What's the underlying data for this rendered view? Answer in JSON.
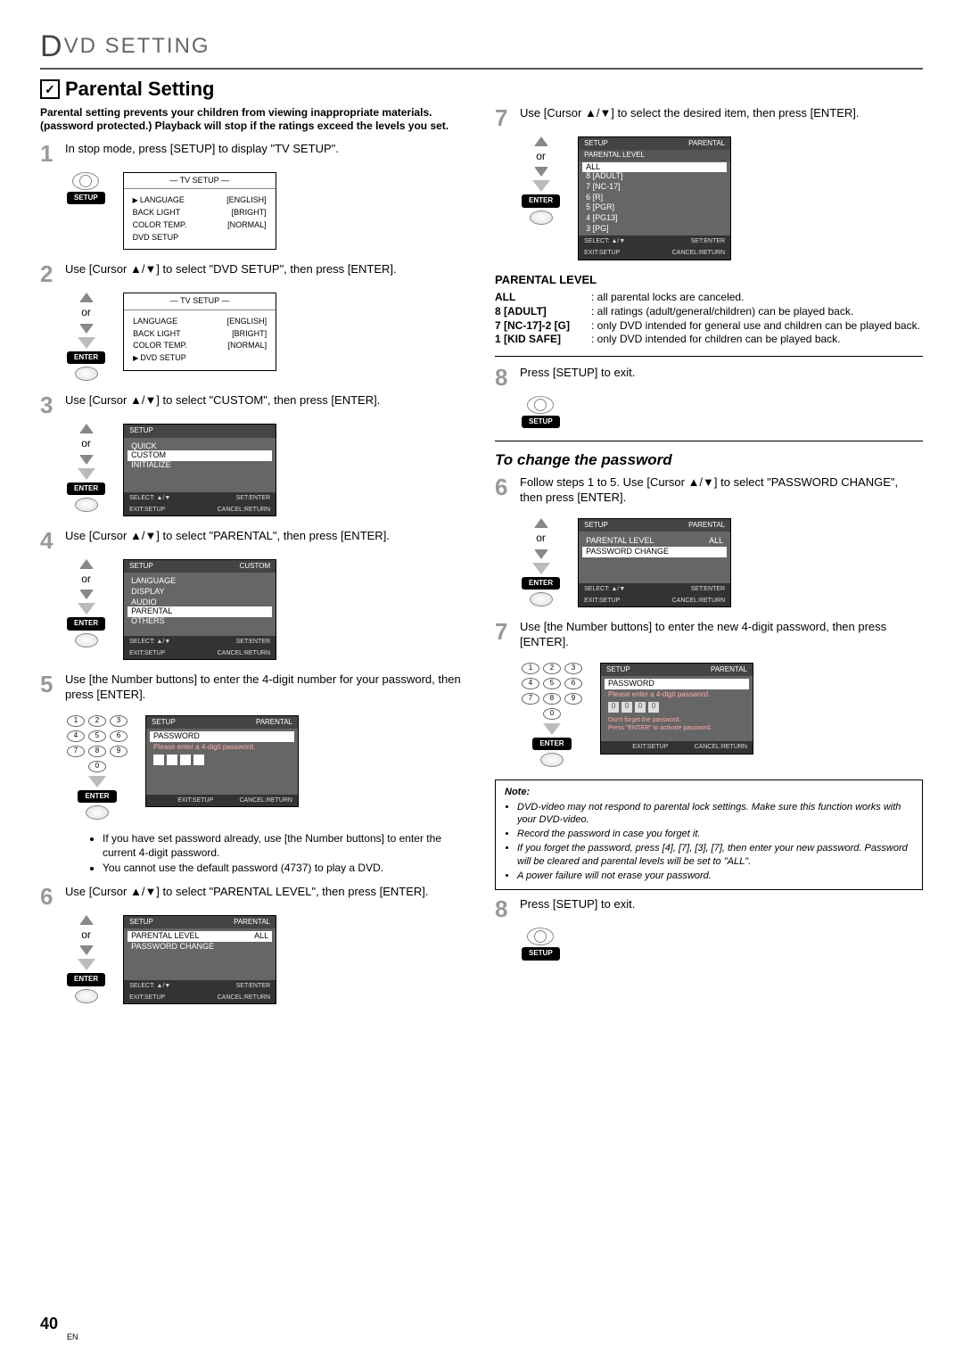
{
  "page_title": {
    "d": "D",
    "rest": "VD SETTING"
  },
  "section_title": "Parental Setting",
  "intro": "Parental setting prevents your children from viewing inappropriate materials. (password protected.) Playback will stop if the ratings exceed the levels you set.",
  "steps": {
    "1": "In stop mode, press [SETUP] to display \"TV SETUP\".",
    "2": "Use [Cursor ▲/▼] to select \"DVD SETUP\", then press [ENTER].",
    "3": "Use [Cursor ▲/▼] to select \"CUSTOM\", then press [ENTER].",
    "4": "Use [Cursor ▲/▼] to select \"PARENTAL\", then press [ENTER].",
    "5": "Use [the Number buttons] to enter the 4-digit number for your password, then press [ENTER].",
    "6": "Use [Cursor ▲/▼] to select \"PARENTAL LEVEL\", then press [ENTER].",
    "7": "Use [Cursor ▲/▼] to select the desired item, then press [ENTER].",
    "8": "Press [SETUP] to exit.",
    "c6": "Follow steps 1 to 5. Use [Cursor ▲/▼] to select \"PASSWORD CHANGE\", then press [ENTER].",
    "c7": "Use [the Number buttons] to enter the new 4-digit password, then press [ENTER].",
    "c8": "Press [SETUP] to exit."
  },
  "remote": {
    "or": "or",
    "enter": "ENTER",
    "setup": "SETUP"
  },
  "tv_setup": {
    "title": "— TV SETUP —",
    "rows": [
      [
        "LANGUAGE",
        "[ENGLISH]"
      ],
      [
        "BACK LIGHT",
        "[BRIGHT]"
      ],
      [
        "COLOR TEMP.",
        "[NORMAL]"
      ],
      [
        "DVD SETUP",
        ""
      ]
    ]
  },
  "setup_menu": {
    "header": "SETUP",
    "items": [
      "QUICK",
      "CUSTOM",
      "INITIALIZE"
    ],
    "selected": "CUSTOM"
  },
  "custom_menu": {
    "header": "SETUP",
    "sub": "CUSTOM",
    "items": [
      "LANGUAGE",
      "DISPLAY",
      "AUDIO",
      "PARENTAL",
      "OTHERS"
    ],
    "selected": "PARENTAL"
  },
  "parental_menu": {
    "header": "SETUP",
    "sub": "PARENTAL",
    "items": [
      [
        "PARENTAL LEVEL",
        "ALL"
      ],
      [
        "PASSWORD CHANGE",
        ""
      ]
    ],
    "selected": "PARENTAL LEVEL"
  },
  "password_menu": {
    "header": "SETUP",
    "sub": "PARENTAL",
    "title": "PASSWORD",
    "prompt": "Please enter a 4-digit password."
  },
  "password_menu2": {
    "remind": "Don't forget the password.",
    "activate": "Press \"ENTER\" to activate password."
  },
  "parental_level_menu": {
    "header": "SETUP",
    "sub": "PARENTAL",
    "title": "PARENTAL LEVEL",
    "items": [
      "ALL",
      "8 [ADULT]",
      "7 [NC-17]",
      "6 [R]",
      "5 [PGR]",
      "4 [PG13]",
      "3 [PG]"
    ],
    "selected": "ALL"
  },
  "pwchange_menu": {
    "items": [
      [
        "PARENTAL LEVEL",
        "ALL"
      ],
      [
        "PASSWORD CHANGE",
        ""
      ]
    ],
    "selected": "PASSWORD CHANGE"
  },
  "footer": {
    "select": "SELECT: ▲/▼",
    "set": "SET:ENTER",
    "exit": "EXIT:SETUP",
    "cancel": "CANCEL:RETURN"
  },
  "bullets5": [
    "If you have set password already, use [the Number buttons] to enter the current 4-digit password.",
    "You cannot use the default password (4737) to play a DVD."
  ],
  "plevel_heading": "PARENTAL LEVEL",
  "plevel": [
    [
      "ALL",
      ": all parental locks are canceled."
    ],
    [
      "8 [ADULT]",
      ": all ratings (adult/general/children) can be played back."
    ],
    [
      "7 [NC-17]-2 [G]",
      ": only DVD intended for general use and children can be played back."
    ],
    [
      "1 [KID SAFE]",
      ": only DVD intended for children can be played back."
    ]
  ],
  "change_pw_title": "To change the password",
  "note": {
    "title": "Note:",
    "items": [
      "DVD-video may not respond to parental lock settings. Make sure this function works with your DVD-video.",
      "Record the password in case you forget it.",
      "If you forget the password, press [4], [7], [3], [7], then enter your new password. Password will be cleared and parental levels will be set to \"ALL\".",
      "A power failure will not erase your password."
    ]
  },
  "page_num": "40",
  "lang": "EN"
}
